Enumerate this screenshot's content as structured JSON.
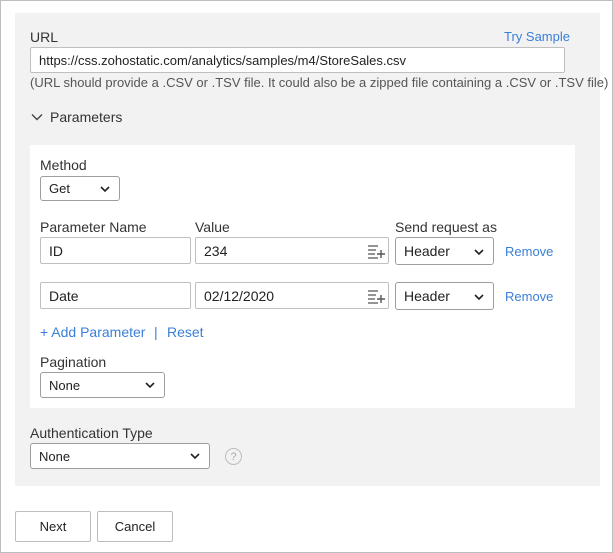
{
  "url_section": {
    "label": "URL",
    "try_sample": "Try Sample",
    "value": "https://css.zohostatic.com/analytics/samples/m4/StoreSales.csv",
    "hint": "(URL should provide a .CSV or .TSV file. It could also be a zipped file containing a .CSV or .TSV file)"
  },
  "parameters": {
    "toggle_label": "Parameters",
    "method_label": "Method",
    "method_value": "Get",
    "col_name": "Parameter Name",
    "col_value": "Value",
    "col_send": "Send request as",
    "rows": [
      {
        "name": "ID",
        "value": "234",
        "send_as": "Header",
        "remove": "Remove"
      },
      {
        "name": "Date",
        "value": "02/12/2020",
        "send_as": "Header",
        "remove": "Remove"
      }
    ],
    "add_label": "+ Add Parameter",
    "separator": "|",
    "reset_label": "Reset",
    "pagination_label": "Pagination",
    "pagination_value": "None"
  },
  "auth": {
    "label": "Authentication Type",
    "value": "None",
    "help": "?"
  },
  "footer": {
    "next": "Next",
    "cancel": "Cancel"
  }
}
